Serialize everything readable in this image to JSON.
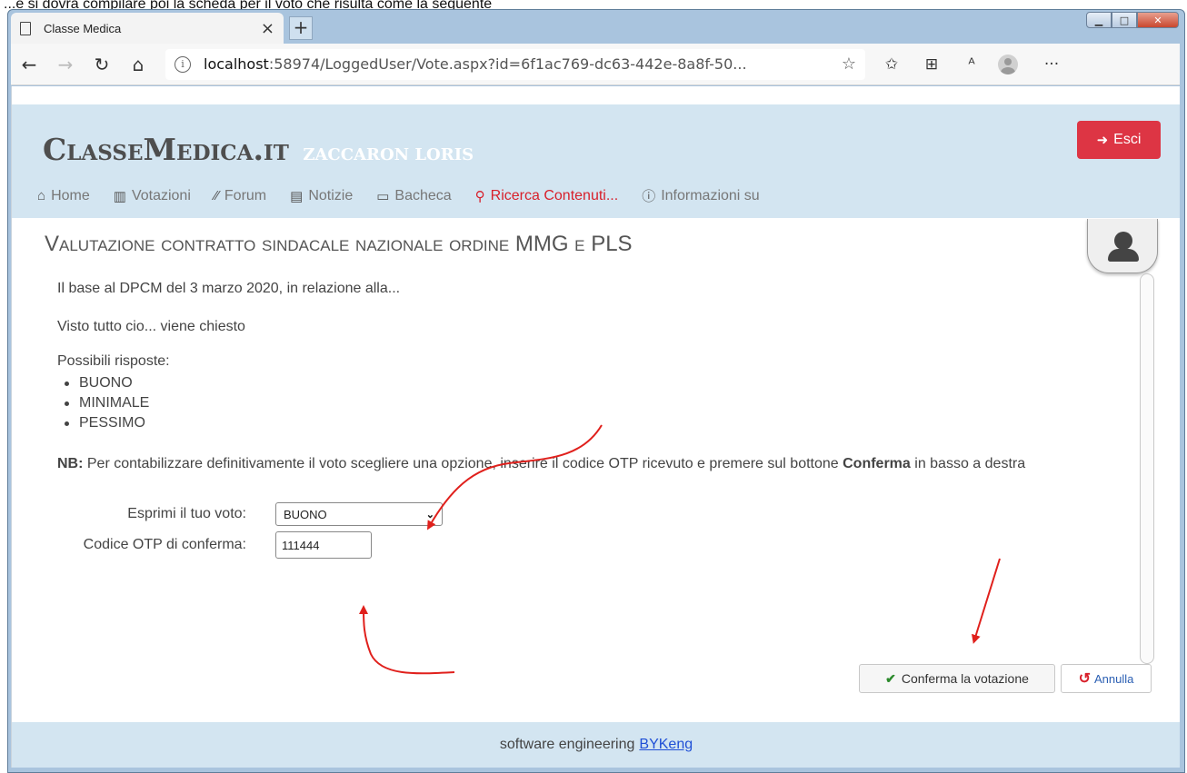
{
  "caption": "...e si dovrà compilare poi la scheda per il voto che risulta come la seguente",
  "browser": {
    "tab_title": "Classe Medica",
    "tab_close": "×",
    "new_tab": "+",
    "url_host": "localhost",
    "url_path": ":58974/LoggedUser/Vote.aspx?id=6f1ac769-dc63-442e-8a8f-50...",
    "info_icon": "i",
    "menu_dots": "···",
    "icons": [
      "back-icon",
      "forward-icon",
      "refresh-icon",
      "home-icon",
      "favorite-star-icon",
      "favorites-list-icon",
      "collections-icon",
      "read-aloud-icon",
      "profile-icon",
      "more-icon"
    ]
  },
  "header": {
    "brand": "ClasseMedica.it",
    "user": "Zaccaron Loris",
    "logout_label": "Esci",
    "nav": [
      {
        "label": "Home",
        "icon": "home-icon"
      },
      {
        "label": "Votazioni",
        "icon": "ballot-icon"
      },
      {
        "label": "Forum",
        "icon": "forum-icon"
      },
      {
        "label": "Notizie",
        "icon": "news-icon"
      },
      {
        "label": "Bacheca",
        "icon": "board-icon"
      },
      {
        "label": "Ricerca Contenuti...",
        "icon": "search-icon",
        "active": true
      },
      {
        "label": "Informazioni su",
        "icon": "info-icon"
      }
    ]
  },
  "main": {
    "title": "Valutazione contratto sindacale nazionale ordine MMG e PLS",
    "intro": "Il base al DPCM del 3 marzo 2020, in relazione alla...",
    "question": "Visto tutto cio... viene chiesto",
    "answers_label": "Possibili risposte:",
    "answers": [
      "BUONO",
      "MINIMALE",
      "PESSIMO"
    ],
    "nb_prefix": "NB:",
    "nb_text": " Per contabilizzare definitivamente il voto scegliere una opzione, inserire il codice OTP ricevuto e premere sul bottone ",
    "nb_bold": "Conferma",
    "nb_suffix": " in basso a destra",
    "vote_label": "Esprimi il tuo voto:",
    "vote_value": "BUONO",
    "otp_label": "Codice OTP di conferma:",
    "otp_value": "111444",
    "confirm_label": "Conferma la votazione",
    "cancel_label": "Annulla"
  },
  "footer": {
    "text": "software engineering",
    "link": "BYKeng"
  },
  "colors": {
    "header_bg": "#d3e5f1",
    "accent_red": "#dd3544",
    "active_nav": "#d8202b",
    "annotation_arrow": "#e0201c"
  }
}
